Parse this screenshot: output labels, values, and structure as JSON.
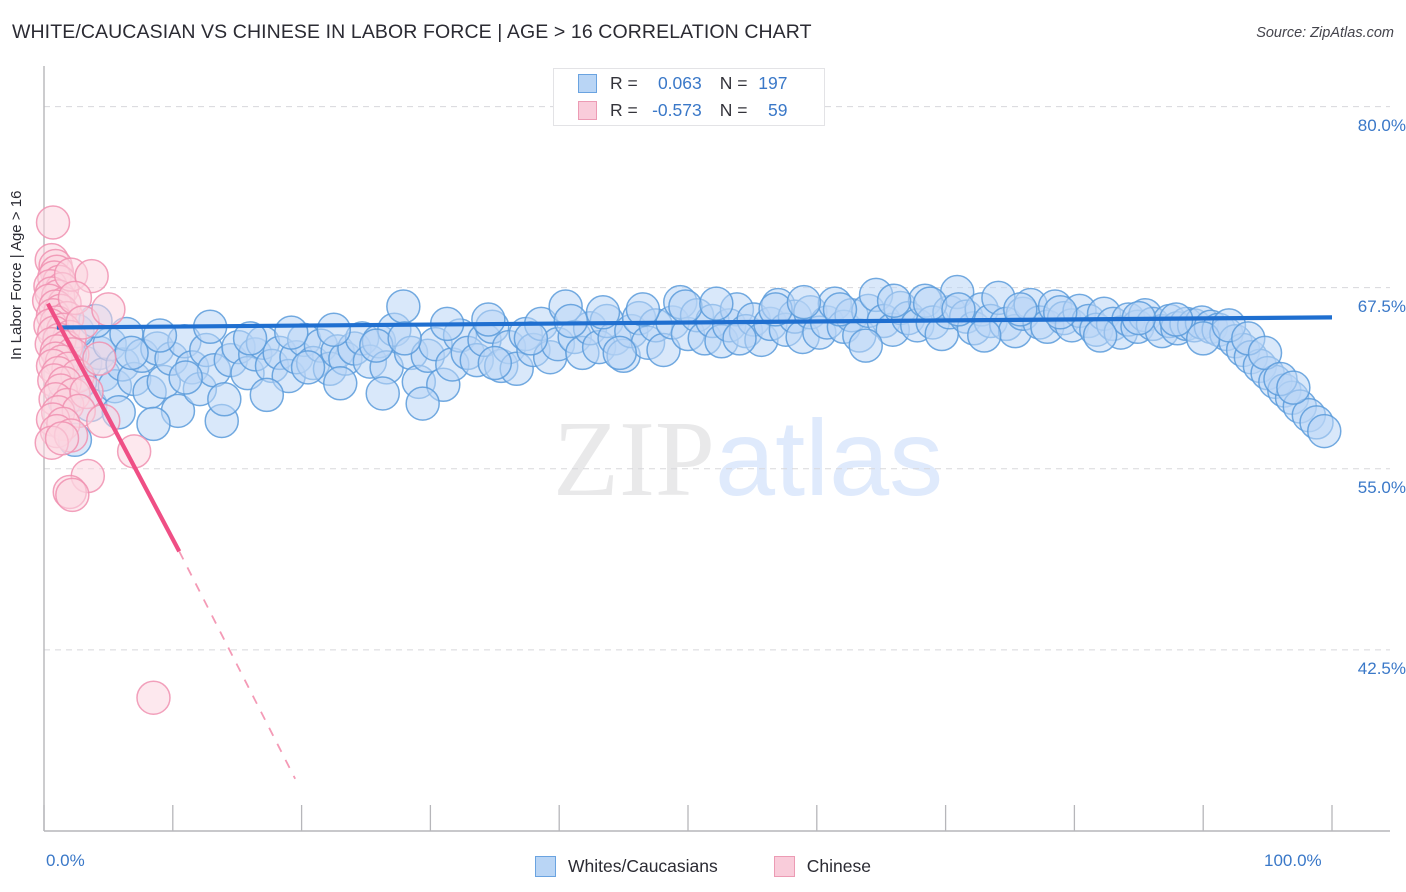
{
  "header": {
    "title": "WHITE/CAUCASIAN VS CHINESE IN LABOR FORCE | AGE > 16 CORRELATION CHART",
    "source": "Source: ZipAtlas.com"
  },
  "watermark": {
    "part1": "ZIP",
    "part2": "atlas"
  },
  "stats_legend": {
    "rows": [
      {
        "color": "#b9d5f5",
        "r_label": "R =",
        "r_value": "0.063",
        "n_label": "N =",
        "n_value": "197"
      },
      {
        "color": "#f9ccda",
        "r_label": "R =",
        "r_value": "-0.573",
        "n_label": "N =",
        "n_value": "59"
      }
    ]
  },
  "bottom_legend": {
    "items": [
      {
        "label": "Whites/Caucasians",
        "color": "#b9d5f5",
        "border": "#6aa3e0"
      },
      {
        "label": "Chinese",
        "color": "#f9ccda",
        "border": "#ec9bb4"
      }
    ]
  },
  "chart_data": {
    "type": "scatter",
    "title": "WHITE/CAUCASIAN VS CHINESE IN LABOR FORCE | AGE > 16 CORRELATION CHART",
    "xlabel": "",
    "ylabel": "In Labor Force | Age > 16",
    "xlim": [
      0,
      100
    ],
    "ylim": [
      30.0,
      82.8
    ],
    "grid": true,
    "legend_position": "bottom-center",
    "x_ticks": [
      "0.0%",
      "100.0%"
    ],
    "x_tick_values": [
      0,
      100
    ],
    "y_ticks": [
      "80.0%",
      "67.5%",
      "55.0%",
      "42.5%"
    ],
    "y_tick_values": [
      80.0,
      67.5,
      55.0,
      42.5
    ],
    "series": [
      {
        "name": "Whites/Caucasians",
        "color": "#b9d5f5",
        "edge": "#5b9bdb",
        "r": 0.063,
        "n": 197,
        "trend": {
          "x0": 1.0,
          "y0": 64.75,
          "x1": 100.0,
          "y1": 65.45,
          "color": "#1f6fd0"
        },
        "points": [
          [
            3.2,
            62.3
          ],
          [
            3.6,
            59.4
          ],
          [
            4.3,
            63.0
          ],
          [
            4.6,
            61.5
          ],
          [
            5.1,
            63.6
          ],
          [
            5.5,
            60.7
          ],
          [
            6.1,
            62.2
          ],
          [
            6.4,
            64.3
          ],
          [
            7.0,
            61.2
          ],
          [
            7.6,
            62.8
          ],
          [
            8.2,
            60.3
          ],
          [
            8.8,
            63.3
          ],
          [
            9.3,
            61.0
          ],
          [
            9.9,
            62.6
          ],
          [
            10.4,
            59.0
          ],
          [
            10.9,
            63.8
          ],
          [
            11.5,
            62.0
          ],
          [
            12.1,
            60.5
          ],
          [
            12.6,
            63.2
          ],
          [
            13.2,
            61.8
          ],
          [
            13.8,
            58.3
          ],
          [
            14.5,
            62.5
          ],
          [
            15.1,
            63.4
          ],
          [
            15.8,
            61.6
          ],
          [
            16.4,
            62.9
          ],
          [
            17.0,
            63.7
          ],
          [
            17.7,
            62.1
          ],
          [
            18.3,
            63.0
          ],
          [
            19.0,
            61.4
          ],
          [
            19.6,
            62.7
          ],
          [
            20.2,
            63.9
          ],
          [
            20.9,
            62.3
          ],
          [
            21.5,
            63.5
          ],
          [
            22.2,
            61.9
          ],
          [
            22.8,
            63.1
          ],
          [
            23.4,
            62.6
          ],
          [
            24.1,
            63.3
          ],
          [
            24.7,
            64.0
          ],
          [
            25.3,
            62.4
          ],
          [
            26.0,
            63.8
          ],
          [
            26.6,
            62.0
          ],
          [
            27.2,
            64.6
          ],
          [
            27.9,
            66.2
          ],
          [
            28.5,
            63.0
          ],
          [
            29.1,
            61.0
          ],
          [
            29.8,
            62.8
          ],
          [
            30.4,
            63.6
          ],
          [
            31.0,
            60.8
          ],
          [
            31.7,
            62.2
          ],
          [
            32.3,
            64.2
          ],
          [
            32.9,
            63.0
          ],
          [
            33.6,
            62.5
          ],
          [
            34.2,
            63.9
          ],
          [
            34.8,
            64.8
          ],
          [
            35.5,
            62.1
          ],
          [
            36.1,
            63.4
          ],
          [
            36.7,
            61.9
          ],
          [
            37.4,
            64.3
          ],
          [
            38.0,
            63.2
          ],
          [
            38.6,
            65.0
          ],
          [
            39.3,
            62.7
          ],
          [
            39.9,
            63.6
          ],
          [
            40.5,
            66.2
          ],
          [
            41.2,
            64.1
          ],
          [
            41.8,
            63.0
          ],
          [
            42.4,
            64.7
          ],
          [
            43.1,
            63.4
          ],
          [
            43.7,
            65.2
          ],
          [
            44.3,
            64.0
          ],
          [
            45.0,
            62.8
          ],
          [
            45.6,
            64.5
          ],
          [
            46.2,
            65.4
          ],
          [
            46.9,
            63.7
          ],
          [
            47.5,
            64.9
          ],
          [
            48.1,
            63.2
          ],
          [
            48.8,
            65.1
          ],
          [
            49.4,
            66.5
          ],
          [
            50.0,
            64.3
          ],
          [
            50.7,
            65.6
          ],
          [
            51.3,
            64.0
          ],
          [
            51.9,
            65.2
          ],
          [
            52.6,
            63.8
          ],
          [
            53.2,
            64.9
          ],
          [
            53.8,
            66.0
          ],
          [
            54.5,
            64.5
          ],
          [
            55.1,
            65.3
          ],
          [
            55.7,
            63.9
          ],
          [
            56.4,
            65.0
          ],
          [
            57.0,
            66.3
          ],
          [
            57.6,
            64.6
          ],
          [
            58.3,
            65.5
          ],
          [
            58.9,
            64.1
          ],
          [
            59.5,
            65.8
          ],
          [
            60.2,
            64.4
          ],
          [
            60.8,
            65.1
          ],
          [
            61.4,
            66.4
          ],
          [
            62.1,
            64.8
          ],
          [
            62.7,
            65.6
          ],
          [
            63.3,
            64.2
          ],
          [
            64.0,
            65.9
          ],
          [
            64.6,
            67.0
          ],
          [
            65.2,
            65.2
          ],
          [
            65.9,
            64.6
          ],
          [
            66.5,
            66.1
          ],
          [
            67.1,
            65.4
          ],
          [
            67.8,
            64.9
          ],
          [
            68.4,
            66.6
          ],
          [
            69.0,
            65.1
          ],
          [
            69.7,
            64.3
          ],
          [
            70.3,
            65.8
          ],
          [
            70.9,
            67.2
          ],
          [
            71.6,
            65.5
          ],
          [
            72.2,
            64.7
          ],
          [
            72.8,
            66.0
          ],
          [
            73.5,
            65.2
          ],
          [
            74.1,
            66.8
          ],
          [
            74.7,
            65.0
          ],
          [
            75.4,
            64.5
          ],
          [
            76.0,
            65.7
          ],
          [
            76.6,
            66.3
          ],
          [
            77.3,
            65.1
          ],
          [
            77.9,
            64.8
          ],
          [
            78.5,
            66.2
          ],
          [
            79.2,
            65.4
          ],
          [
            79.8,
            64.9
          ],
          [
            80.4,
            65.9
          ],
          [
            81.1,
            65.2
          ],
          [
            81.7,
            64.6
          ],
          [
            82.3,
            65.7
          ],
          [
            83.0,
            65.0
          ],
          [
            83.6,
            64.4
          ],
          [
            84.2,
            65.3
          ],
          [
            84.9,
            64.8
          ],
          [
            85.5,
            65.6
          ],
          [
            86.1,
            65.0
          ],
          [
            86.8,
            64.5
          ],
          [
            87.4,
            65.2
          ],
          [
            88.0,
            64.7
          ],
          [
            88.7,
            65.0
          ],
          [
            89.3,
            64.9
          ],
          [
            89.9,
            65.1
          ],
          [
            90.6,
            64.8
          ],
          [
            91.2,
            64.6
          ],
          [
            91.8,
            64.3
          ],
          [
            92.5,
            63.8
          ],
          [
            93.1,
            63.2
          ],
          [
            93.7,
            62.7
          ],
          [
            94.4,
            62.1
          ],
          [
            95.0,
            61.6
          ],
          [
            95.6,
            61.0
          ],
          [
            96.3,
            60.4
          ],
          [
            96.9,
            59.9
          ],
          [
            97.5,
            59.3
          ],
          [
            98.2,
            58.7
          ],
          [
            98.8,
            58.2
          ],
          [
            99.4,
            57.6
          ],
          [
            1.6,
            59.7
          ],
          [
            2.0,
            62.9
          ],
          [
            2.4,
            57.0
          ],
          [
            2.8,
            61.0
          ],
          [
            5.8,
            58.9
          ],
          [
            8.5,
            58.1
          ],
          [
            11.0,
            61.3
          ],
          [
            14.0,
            59.8
          ],
          [
            17.3,
            60.1
          ],
          [
            20.5,
            62.0
          ],
          [
            23.0,
            60.9
          ],
          [
            26.3,
            60.2
          ],
          [
            29.4,
            59.5
          ],
          [
            35.0,
            62.3
          ],
          [
            44.7,
            63.0
          ],
          [
            54.0,
            64.0
          ],
          [
            63.8,
            63.5
          ],
          [
            73.0,
            64.2
          ],
          [
            82.0,
            64.2
          ],
          [
            90.0,
            64.0
          ],
          [
            92.0,
            64.9
          ],
          [
            93.5,
            64.0
          ],
          [
            94.8,
            63.0
          ],
          [
            96.0,
            61.2
          ],
          [
            97.0,
            60.6
          ],
          [
            1.2,
            64.0
          ],
          [
            2.6,
            64.5
          ],
          [
            4.0,
            65.2
          ],
          [
            6.8,
            63.0
          ],
          [
            9.0,
            64.2
          ],
          [
            12.9,
            64.8
          ],
          [
            16.0,
            64.0
          ],
          [
            19.2,
            64.4
          ],
          [
            22.5,
            64.6
          ],
          [
            25.8,
            63.5
          ],
          [
            28.0,
            64.0
          ],
          [
            31.3,
            65.0
          ],
          [
            34.5,
            65.3
          ],
          [
            37.8,
            64.0
          ],
          [
            40.9,
            65.2
          ],
          [
            43.4,
            65.8
          ],
          [
            46.5,
            66.0
          ],
          [
            49.8,
            66.2
          ],
          [
            52.2,
            66.4
          ],
          [
            56.8,
            66.0
          ],
          [
            59.0,
            66.5
          ],
          [
            61.8,
            66.0
          ],
          [
            66.0,
            66.6
          ],
          [
            68.8,
            66.4
          ],
          [
            71.0,
            66.0
          ],
          [
            75.8,
            66.0
          ],
          [
            78.9,
            65.8
          ],
          [
            85.0,
            65.4
          ],
          [
            87.9,
            65.3
          ]
        ]
      },
      {
        "name": "Chinese",
        "color": "#fbd5e0",
        "edge": "#f091b0",
        "r": -0.573,
        "n": 59,
        "trend": {
          "x0": 0.3,
          "y0": 66.4,
          "x1": 10.5,
          "y1": 49.3,
          "color": "#ef4f85"
        },
        "trend_dashed": {
          "x0": 10.5,
          "y0": 49.3,
          "x1": 19.5,
          "y1": 33.6,
          "color": "#f49ab6"
        },
        "points": [
          [
            0.7,
            72.0
          ],
          [
            0.6,
            69.4
          ],
          [
            0.9,
            69.0
          ],
          [
            1.0,
            68.6
          ],
          [
            0.8,
            68.2
          ],
          [
            1.2,
            67.9
          ],
          [
            0.5,
            67.6
          ],
          [
            1.4,
            67.4
          ],
          [
            0.6,
            67.1
          ],
          [
            1.1,
            66.9
          ],
          [
            0.4,
            66.6
          ],
          [
            1.6,
            66.4
          ],
          [
            0.9,
            66.2
          ],
          [
            2.1,
            68.4
          ],
          [
            3.7,
            68.3
          ],
          [
            1.3,
            65.9
          ],
          [
            0.7,
            65.6
          ],
          [
            1.8,
            65.4
          ],
          [
            1.0,
            65.1
          ],
          [
            2.4,
            66.8
          ],
          [
            0.5,
            64.9
          ],
          [
            1.5,
            64.6
          ],
          [
            0.8,
            64.4
          ],
          [
            2.0,
            64.1
          ],
          [
            1.2,
            63.9
          ],
          [
            0.6,
            63.6
          ],
          [
            1.7,
            63.4
          ],
          [
            3.0,
            65.1
          ],
          [
            5.0,
            66.0
          ],
          [
            1.0,
            63.1
          ],
          [
            2.2,
            62.9
          ],
          [
            0.9,
            62.6
          ],
          [
            1.4,
            62.4
          ],
          [
            0.7,
            62.1
          ],
          [
            1.9,
            61.9
          ],
          [
            1.1,
            61.6
          ],
          [
            2.6,
            61.4
          ],
          [
            0.8,
            61.1
          ],
          [
            1.6,
            60.9
          ],
          [
            4.3,
            62.6
          ],
          [
            1.3,
            60.4
          ],
          [
            2.3,
            60.1
          ],
          [
            0.9,
            59.8
          ],
          [
            1.8,
            59.4
          ],
          [
            3.3,
            60.3
          ],
          [
            1.1,
            58.9
          ],
          [
            2.7,
            59.0
          ],
          [
            0.7,
            58.4
          ],
          [
            1.5,
            58.1
          ],
          [
            4.6,
            58.3
          ],
          [
            1.0,
            57.6
          ],
          [
            2.1,
            57.3
          ],
          [
            0.6,
            56.8
          ],
          [
            1.4,
            57.1
          ],
          [
            7.0,
            56.2
          ],
          [
            3.4,
            54.5
          ],
          [
            2.0,
            53.4
          ],
          [
            2.2,
            53.2
          ],
          [
            8.5,
            39.2
          ]
        ]
      }
    ]
  }
}
